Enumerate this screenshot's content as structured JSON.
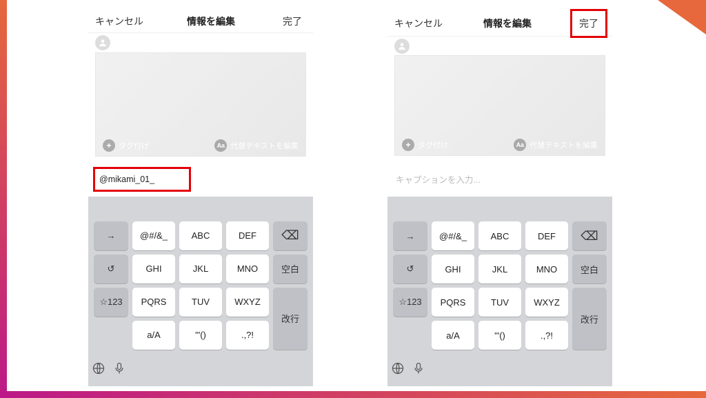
{
  "nav": {
    "cancel": "キャンセル",
    "title": "情報を編集",
    "done": "完了"
  },
  "media": {
    "tag_label": "タグ付け",
    "alt_label": "代替テキストを編集"
  },
  "caption": {
    "value_left": "@mikami_01_",
    "placeholder_right": "キャプションを入力..."
  },
  "keyboard": {
    "arrow": "→",
    "r1c1": "@#/&_",
    "r1c2": "ABC",
    "r1c3": "DEF",
    "backspace": "⌫",
    "undo": "↺",
    "r2c1": "GHI",
    "r2c2": "JKL",
    "r2c3": "MNO",
    "space": "空白",
    "numsym": "☆123",
    "r3c1": "PQRS",
    "r3c2": "TUV",
    "r3c3": "WXYZ",
    "enter": "改行",
    "r4c1": "a/A",
    "r4c2": "'\"()",
    "r4c3": ".,?!"
  }
}
